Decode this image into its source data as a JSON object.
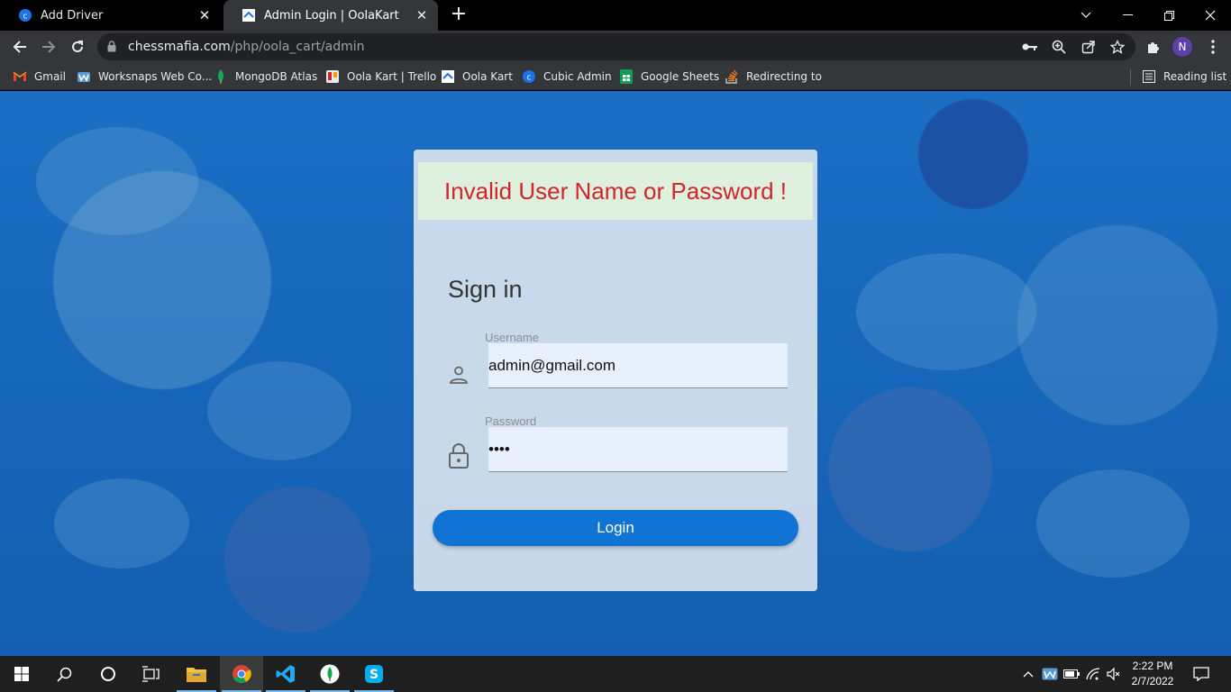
{
  "browser": {
    "tabs": [
      {
        "label": "Add Driver",
        "active": false
      },
      {
        "label": "Admin Login | OolaKart",
        "active": true
      }
    ],
    "url_host": "chessmafia.com",
    "url_path": "/php/oola_cart/admin",
    "profile_initial": "N",
    "bookmarks": [
      {
        "label": "Gmail",
        "icon": "gmail-icon"
      },
      {
        "label": "Worksnaps Web Co...",
        "icon": "worksnaps-icon"
      },
      {
        "label": "MongoDB Atlas",
        "icon": "mongodb-icon"
      },
      {
        "label": "Oola Kart | Trello",
        "icon": "trello-icon"
      },
      {
        "label": "Oola Kart",
        "icon": "oolakart-icon"
      },
      {
        "label": "Cubic Admin",
        "icon": "cubic-icon"
      },
      {
        "label": "Google Sheets",
        "icon": "sheets-icon"
      },
      {
        "label": "Redirecting to",
        "icon": "stackoverflow-icon"
      }
    ],
    "reading_list": "Reading list"
  },
  "login": {
    "error": "Invalid User Name or Password !",
    "title": "Sign in",
    "username_label": "Username",
    "username_value": "admin@gmail.com",
    "password_label": "Password",
    "password_value": "abcd",
    "button": "Login"
  },
  "taskbar": {
    "time": "2:22 PM",
    "date": "2/7/2022",
    "apps": [
      "windows-start-icon",
      "search-icon",
      "cortana-icon",
      "task-view-icon",
      "file-explorer-icon",
      "chrome-icon",
      "vscode-icon",
      "mongodb-compass-icon",
      "skype-icon"
    ]
  },
  "colors": {
    "accent": "#1173d4",
    "error_text": "#d0262b",
    "error_bg": "#e0f0de"
  }
}
